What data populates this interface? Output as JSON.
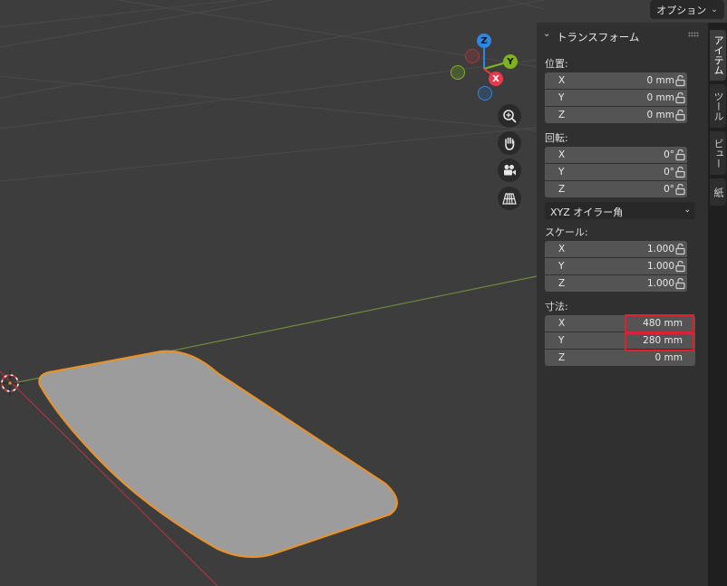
{
  "header": {
    "options_label": "オプション",
    "options_icon": "chevron-down-icon"
  },
  "gizmo": {
    "z_label": "Z",
    "y_label": "Y",
    "x_label": "X",
    "colors": {
      "z": "#2f86e0",
      "y": "#7fb31d",
      "x": "#e83a4c"
    }
  },
  "nav_tools": [
    "zoom-icon",
    "hand-pan-icon",
    "camera-icon",
    "perspective-grid-icon"
  ],
  "panel": {
    "title": "トランスフォーム",
    "location": {
      "label": "位置:",
      "rows": [
        {
          "axis": "X",
          "value": "0 mm"
        },
        {
          "axis": "Y",
          "value": "0 mm"
        },
        {
          "axis": "Z",
          "value": "0 mm"
        }
      ]
    },
    "rotation": {
      "label": "回転:",
      "rows": [
        {
          "axis": "X",
          "value": "0°"
        },
        {
          "axis": "Y",
          "value": "0°"
        },
        {
          "axis": "Z",
          "value": "0°"
        }
      ],
      "mode": "XYZ オイラー角"
    },
    "scale": {
      "label": "スケール:",
      "rows": [
        {
          "axis": "X",
          "value": "1.000"
        },
        {
          "axis": "Y",
          "value": "1.000"
        },
        {
          "axis": "Z",
          "value": "1.000"
        }
      ]
    },
    "dimensions": {
      "label": "寸法:",
      "rows": [
        {
          "axis": "X",
          "value": "480 mm"
        },
        {
          "axis": "Y",
          "value": "280 mm"
        },
        {
          "axis": "Z",
          "value": "0 mm"
        }
      ]
    }
  },
  "side_tabs": [
    "アイテム",
    "ツール",
    "ビュー",
    "紙"
  ],
  "colors": {
    "selection_outline": "#e8922e",
    "highlight_box": "#e0202a",
    "mesh_fill": "#9c9c9c"
  }
}
